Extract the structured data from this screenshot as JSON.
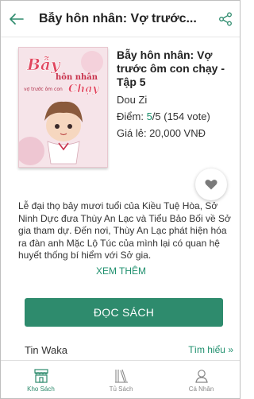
{
  "header": {
    "title": "Bẫy hôn nhân: Vợ trước...",
    "back_icon": "arrow-left-icon",
    "share_icon": "share-icon"
  },
  "book": {
    "title": "Bẫy hôn nhân: Vợ trước ôm con chạy - Tập 5",
    "author": "Dou Zi",
    "rating_prefix": "Điểm: ",
    "rating_score": "5",
    "rating_suffix": "/5 (154 vote)",
    "price": "Giá lẻ: 20,000 VNĐ",
    "cover": {
      "line1": "Bẫy",
      "line2": "hôn nhân",
      "line3": "vợ trước ôm con",
      "line4": "Chạy"
    }
  },
  "description": "Lễ đại thọ bảy mươi tuổi của Kiều Tuệ Hòa, Sở Ninh Dực đưa Thùy An Lạc và Tiểu Bảo Bối về Sở gia tham dự. Đến nơi, Thùy An Lạc phát hiện hóa ra đàn anh Mặc Lộ Túc của mình lại có quan hệ huyết thống bí hiểm với Sở gia.",
  "more_label": "XEM THÊM",
  "read_label": "ĐỌC SÁCH",
  "waka": {
    "title": "Tin Waka",
    "link": "Tìm hiểu »"
  },
  "nav": {
    "items": [
      {
        "label": "Kho Sách",
        "icon": "store-icon"
      },
      {
        "label": "Tủ Sách",
        "icon": "bookshelf-icon"
      },
      {
        "label": "Cá Nhân",
        "icon": "user-icon"
      }
    ]
  },
  "colors": {
    "accent": "#2e8b6d",
    "link": "#1e8f6d"
  }
}
